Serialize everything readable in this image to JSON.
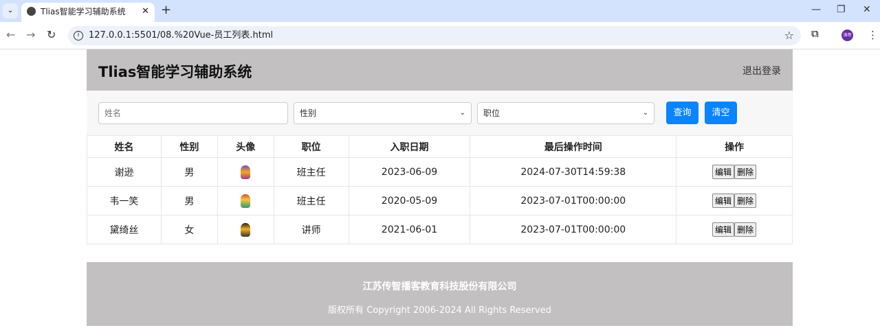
{
  "browser": {
    "tab_title": "Tlias智能学习辅助系统",
    "url": "127.0.0.1:5501/08.%20Vue-员工列表.html",
    "profile": "涛哥"
  },
  "header": {
    "title": "Tlias智能学习辅助系统",
    "logout": "退出登录"
  },
  "filters": {
    "name_placeholder": "姓名",
    "gender": "性别",
    "job": "职位",
    "query": "查询",
    "clear": "清空",
    "accent": "#0a84ff"
  },
  "table": {
    "headers": [
      "姓名",
      "性别",
      "头像",
      "职位",
      "入职日期",
      "最后操作时间",
      "操作"
    ],
    "rows": [
      {
        "name": "谢逊",
        "gender": "男",
        "job": "班主任",
        "entry": "2023-06-09",
        "updated": "2024-07-30T14:59:38"
      },
      {
        "name": "韦一笑",
        "gender": "男",
        "job": "班主任",
        "entry": "2020-05-09",
        "updated": "2023-07-01T00:00:00"
      },
      {
        "name": "黛绮丝",
        "gender": "女",
        "job": "讲师",
        "entry": "2021-06-01",
        "updated": "2023-07-01T00:00:00"
      }
    ],
    "edit": "编辑",
    "delete": "删除"
  },
  "footer": {
    "company": "江苏传智播客教育科技股份有限公司",
    "copyright": "版权所有 Copyright 2006-2024 All Rights Reserved"
  }
}
